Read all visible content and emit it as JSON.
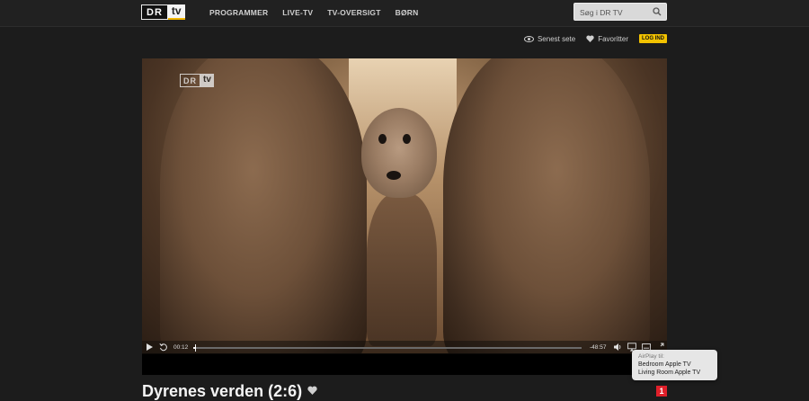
{
  "header": {
    "logo": {
      "dr": "DR",
      "tv": "tv"
    },
    "nav": [
      "PROGRAMMER",
      "LIVE-TV",
      "TV-OVERSIGT",
      "BØRN"
    ],
    "search": {
      "placeholder": "Søg i DR TV"
    }
  },
  "subnav": {
    "recent": "Senest sete",
    "favorites": "Favoritter",
    "login": "LOG IND"
  },
  "player": {
    "watermark": {
      "dr": "DR",
      "tv": "tv"
    },
    "time_elapsed": "00:12",
    "time_remaining": "-48:57",
    "progress": 0.004
  },
  "airplay": {
    "title": "AirPlay til:",
    "devices": [
      "Bedroom Apple TV",
      "Living Room Apple TV"
    ]
  },
  "program": {
    "title": "Dyrenes verden (2:6)",
    "channel": "1"
  },
  "colors": {
    "accent_yellow": "#f2c200",
    "channel_red": "#e0202a",
    "background": "#1c1c1c"
  }
}
